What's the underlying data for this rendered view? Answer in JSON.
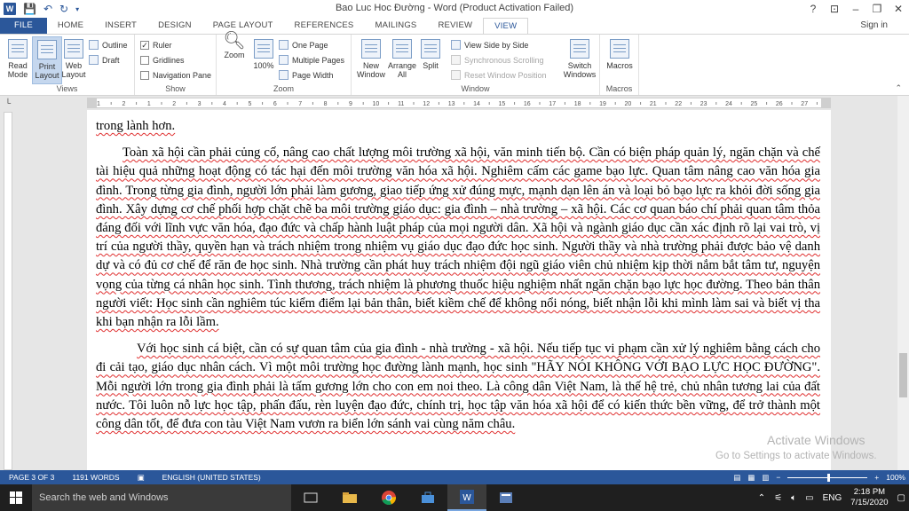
{
  "titlebar": {
    "title": "Bao Luc Hoc Đường - Word (Product Activation Failed)",
    "app_icon": "W",
    "help": "?",
    "ribbon_display": "⊡",
    "minimize": "–",
    "maximize": "❐",
    "close": "✕"
  },
  "tabs": [
    {
      "label": "FILE"
    },
    {
      "label": "HOME"
    },
    {
      "label": "INSERT"
    },
    {
      "label": "DESIGN"
    },
    {
      "label": "PAGE LAYOUT"
    },
    {
      "label": "REFERENCES"
    },
    {
      "label": "MAILINGS"
    },
    {
      "label": "REVIEW"
    },
    {
      "label": "VIEW"
    }
  ],
  "signin": "Sign in",
  "ribbon": {
    "views": {
      "label": "Views",
      "read_mode": "Read Mode",
      "print_layout": "Print Layout",
      "web_layout": "Web Layout",
      "outline": "Outline",
      "draft": "Draft"
    },
    "show": {
      "label": "Show",
      "ruler": "Ruler",
      "gridlines": "Gridlines",
      "navigation_pane": "Navigation Pane",
      "ruler_checked": true,
      "gridlines_checked": false,
      "navigation_checked": false
    },
    "zoom": {
      "label": "Zoom",
      "zoom": "Zoom",
      "hundred": "100%",
      "one_page": "One Page",
      "multiple_pages": "Multiple Pages",
      "page_width": "Page Width"
    },
    "window": {
      "label": "Window",
      "new_window": "New Window",
      "arrange_all": "Arrange All",
      "split": "Split",
      "view_side_by_side": "View Side by Side",
      "synchronous_scrolling": "Synchronous Scrolling",
      "reset_window_position": "Reset Window Position",
      "switch_windows": "Switch Windows"
    },
    "macros": {
      "label": "Macros",
      "macros": "Macros"
    }
  },
  "ruler_numbers": [
    "1",
    "2",
    "1",
    "2",
    "3",
    "4",
    "5",
    "6",
    "7",
    "8",
    "9",
    "10",
    "11",
    "12",
    "13",
    "14",
    "15",
    "16",
    "17",
    "18",
    "19",
    "20",
    "21",
    "22",
    "23",
    "24",
    "25",
    "26",
    "27"
  ],
  "document": {
    "p0": "trong lành hơn.",
    "p1": "Toàn xã hội cần phải củng cố, nâng cao chất lượng môi trường xã hội, văn minh tiến bộ. Cần có biện pháp quản lý, ngăn chặn và chế tài hiệu quả những hoạt động có tác hại đến môi trường văn hóa xã hội. Nghiêm cấm các game bạo lực. Quan tâm nâng cao văn hóa gia đình. Trong từng gia đình, người lớn phải làm gương, giao tiếp ứng xử đúng mực, mạnh dạn lên án và loại bỏ bạo lực ra khỏi đời sống gia đình. Xây dựng cơ chế phối hợp chặt chẽ ba môi trường giáo dục: gia đình – nhà trường – xã hội. Các cơ quan báo chí phải quan tâm thỏa đáng đối với lĩnh vực văn hóa, đạo đức và chấp hành luật pháp của mọi người dân. Xã hội và ngành giáo dục cần xác định rõ lại vai trò, vị trí của người thầy, quyền hạn và trách nhiệm trong nhiệm vụ giáo dục đạo đức học sinh. Người thầy và nhà trường phải được bảo vệ danh dự và có đủ cơ chế để răn đe học sinh. Nhà trường cần phát huy trách nhiệm đội ngũ giáo viên chủ nhiệm kịp thời nắm bắt tâm tư, nguyện vọng của từng cá nhân học sinh. Tình thương, trách nhiệm là phương thuốc hiệu nghiệm nhất ngăn chặn bạo lực học đường. Theo bản thân người viết: Học sinh cần nghiêm túc kiểm điểm lại bản thân, biết kiềm chế để không nổi nóng, biết nhận lỗi khi mình làm sai và biết vị tha khi bạn nhận ra lỗi lầm.",
    "p2": "Với học sinh cá biệt, cần có sự quan tâm của gia đình - nhà trường - xã hội. Nếu tiếp tục vi phạm cần xử lý nghiêm bằng cách cho đi cải tạo, giáo dục nhân cách. Vì một môi trường học đường lành mạnh, học sinh \"HÃY NÓI KHÔNG VỚI BẠO LỰC HỌC ĐƯỜNG\". Mỗi người lớn trong gia đình phải là tấm gương lớn cho con em noi theo. Là công dân Việt Nam, là thế hệ trẻ, chủ nhân tương lai của đất nước. Tôi luôn nỗ lực học tập, phấn đấu, rèn luyện đạo đức, chính trị, học tập văn hóa xã hội để có kiến thức bền vững, để trở thành một công dân tốt, để đưa con tàu Việt Nam vươn ra biển lớn sánh vai cùng năm châu."
  },
  "watermark": {
    "line1": "Activate Windows",
    "line2": "Go to Settings to activate Windows."
  },
  "status": {
    "page": "PAGE 3 OF 3",
    "words": "1191 WORDS",
    "language": "ENGLISH (UNITED STATES)",
    "zoom": "100%",
    "minus": "−",
    "plus": "+",
    "zoom_fraction": 0.5
  },
  "taskbar": {
    "search_placeholder": "Search the web and Windows",
    "language": "ENG",
    "time": "2:18 PM",
    "date": "7/15/2020"
  },
  "colors": {
    "accent": "#2b579a",
    "squiggle": "#e03030",
    "taskbar": "#1f1f1f"
  }
}
